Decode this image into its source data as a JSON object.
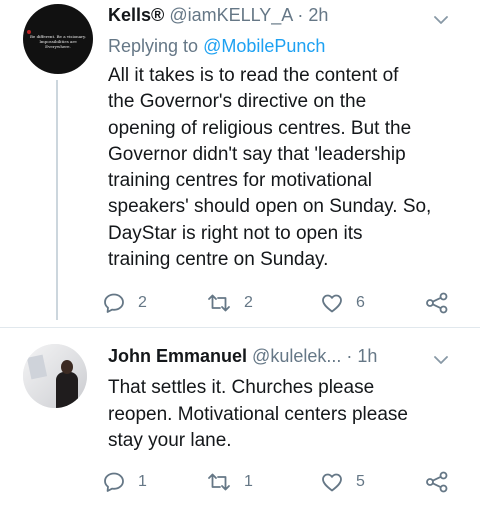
{
  "tweets": [
    {
      "name": "Kells®",
      "handle": "@iamKELLY_A",
      "separator": "·",
      "time": "2h",
      "replying_prefix": "Replying to",
      "replying_handle": "@MobilePunch",
      "avatar_text": "Be different. Be a visionary. Impossibilities are Everywhere.",
      "body_lines": [
        "All it takes is to read the content of",
        "the Governor's directive on the",
        "opening of religious centres. But the",
        "Governor didn't say that 'leadership",
        "training centres for motivational",
        "speakers' should open on Sunday. So,",
        "DayStar is right not to open its",
        "training centre on Sunday."
      ],
      "actions": {
        "reply": "2",
        "retweet": "2",
        "like": "6"
      }
    },
    {
      "name": "John Emmanuel",
      "handle": "@kulelek...",
      "separator": "·",
      "time": "1h",
      "body_lines": [
        "That settles it. Churches please",
        "reopen. Motivational centers please",
        "stay your lane."
      ],
      "actions": {
        "reply": "1",
        "retweet": "1",
        "like": "5"
      }
    }
  ],
  "icons": {
    "reply": "reply-icon",
    "retweet": "retweet-icon",
    "like": "heart-icon",
    "share": "share-icon",
    "menu": "chevron-down-icon"
  },
  "colors": {
    "text": "#14171a",
    "secondary": "#657786",
    "link": "#1da1f2",
    "divider": "#e1e8ed"
  }
}
